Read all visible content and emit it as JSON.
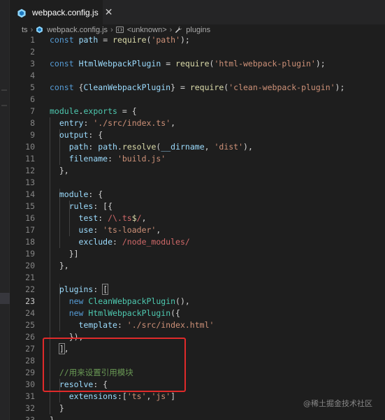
{
  "tab": {
    "filename": "webpack.config.js",
    "close_glyph": "✕",
    "icon": "gear-file-icon"
  },
  "breadcrumb": {
    "items": [
      {
        "label": "ts",
        "icon": ""
      },
      {
        "label": "webpack.config.js",
        "icon": "gear-file-icon"
      },
      {
        "label": "<unknown>",
        "icon": "braces-icon"
      },
      {
        "label": "plugins",
        "icon": "wrench-icon"
      }
    ]
  },
  "editor": {
    "active_line": 23,
    "lines": [
      [
        [
          "kw",
          "const"
        ],
        [
          "p",
          " "
        ],
        [
          "var",
          "path"
        ],
        [
          "p",
          " = "
        ],
        [
          "fn",
          "require"
        ],
        [
          "p",
          "("
        ],
        [
          "str",
          "'path'"
        ],
        [
          "p",
          ");"
        ]
      ],
      [],
      [
        [
          "kw",
          "const"
        ],
        [
          "p",
          " "
        ],
        [
          "var",
          "HtmlWebpackPlugin"
        ],
        [
          "p",
          " = "
        ],
        [
          "fn",
          "require"
        ],
        [
          "p",
          "("
        ],
        [
          "str",
          "'html-webpack-plugin'"
        ],
        [
          "p",
          ");"
        ]
      ],
      [],
      [
        [
          "kw",
          "const"
        ],
        [
          "p",
          " {"
        ],
        [
          "var",
          "CleanWebpackPlugin"
        ],
        [
          "p",
          "} = "
        ],
        [
          "fn",
          "require"
        ],
        [
          "p",
          "("
        ],
        [
          "str",
          "'clean-webpack-plugin'"
        ],
        [
          "p",
          ");"
        ]
      ],
      [],
      [
        [
          "cls",
          "module"
        ],
        [
          "p",
          "."
        ],
        [
          "cls",
          "exports"
        ],
        [
          "p",
          " = {"
        ]
      ],
      [
        [
          "p",
          "  "
        ],
        [
          "var",
          "entry"
        ],
        [
          "p",
          ": "
        ],
        [
          "str",
          "'./src/index.ts'"
        ],
        [
          "p",
          ","
        ]
      ],
      [
        [
          "p",
          "  "
        ],
        [
          "var",
          "output"
        ],
        [
          "p",
          ": {"
        ]
      ],
      [
        [
          "p",
          "    "
        ],
        [
          "var",
          "path"
        ],
        [
          "p",
          ": "
        ],
        [
          "var",
          "path"
        ],
        [
          "p",
          "."
        ],
        [
          "fn",
          "resolve"
        ],
        [
          "p",
          "("
        ],
        [
          "var",
          "__dirname"
        ],
        [
          "p",
          ", "
        ],
        [
          "str",
          "'dist'"
        ],
        [
          "p",
          "),"
        ]
      ],
      [
        [
          "p",
          "    "
        ],
        [
          "var",
          "filename"
        ],
        [
          "p",
          ": "
        ],
        [
          "str",
          "'build.js'"
        ]
      ],
      [
        [
          "p",
          "  },"
        ]
      ],
      [],
      [
        [
          "p",
          "  "
        ],
        [
          "var",
          "module"
        ],
        [
          "p",
          ": {"
        ]
      ],
      [
        [
          "p",
          "    "
        ],
        [
          "var",
          "rules"
        ],
        [
          "p",
          ": [{"
        ]
      ],
      [
        [
          "p",
          "      "
        ],
        [
          "var",
          "test"
        ],
        [
          "p",
          ": "
        ],
        [
          "rx",
          "/\\.ts"
        ],
        [
          "rxs",
          "$"
        ],
        [
          "rx",
          "/"
        ],
        [
          "p",
          ","
        ]
      ],
      [
        [
          "p",
          "      "
        ],
        [
          "var",
          "use"
        ],
        [
          "p",
          ": "
        ],
        [
          "str",
          "'ts-loader'"
        ],
        [
          "p",
          ","
        ]
      ],
      [
        [
          "p",
          "      "
        ],
        [
          "var",
          "exclude"
        ],
        [
          "p",
          ": "
        ],
        [
          "rx",
          "/node_modules/"
        ]
      ],
      [
        [
          "p",
          "    }]"
        ]
      ],
      [
        [
          "p",
          "  },"
        ]
      ],
      [],
      [
        [
          "p",
          "  "
        ],
        [
          "var",
          "plugins"
        ],
        [
          "p",
          ": "
        ],
        [
          "pb",
          "["
        ]
      ],
      [
        [
          "p",
          "    "
        ],
        [
          "kw",
          "new"
        ],
        [
          "p",
          " "
        ],
        [
          "cls",
          "CleanWebpackPlugin"
        ],
        [
          "p",
          "(),"
        ]
      ],
      [
        [
          "p",
          "    "
        ],
        [
          "kw",
          "new"
        ],
        [
          "p",
          " "
        ],
        [
          "cls",
          "HtmlWebpackPlugin"
        ],
        [
          "p",
          "({"
        ]
      ],
      [
        [
          "p",
          "      "
        ],
        [
          "var",
          "template"
        ],
        [
          "p",
          ": "
        ],
        [
          "str",
          "'./src/index.html'"
        ]
      ],
      [
        [
          "p",
          "    }),"
        ]
      ],
      [
        [
          "p",
          "  "
        ],
        [
          "pb",
          "]"
        ],
        [
          "p",
          ","
        ]
      ],
      [],
      [
        [
          "p",
          "  "
        ],
        [
          "cmt",
          "//用来设置引用模块"
        ]
      ],
      [
        [
          "p",
          "  "
        ],
        [
          "var",
          "resolve"
        ],
        [
          "p",
          ": {"
        ]
      ],
      [
        [
          "p",
          "    "
        ],
        [
          "var",
          "extensions"
        ],
        [
          "p",
          ":["
        ],
        [
          "str",
          "'ts'"
        ],
        [
          "p",
          ","
        ],
        [
          "str",
          "'js'"
        ],
        [
          "p",
          "]"
        ]
      ],
      [
        [
          "p",
          "  }"
        ]
      ],
      [
        [
          "p",
          "}"
        ]
      ]
    ]
  },
  "watermark": "@稀土掘金技术社区",
  "colors": {
    "background": "#1e1e1e",
    "keyword": "#569cd6",
    "variable": "#9cdcfe",
    "function": "#dcdcaa",
    "string": "#ce9178",
    "class": "#4ec9b0",
    "comment": "#6a9955",
    "regex": "#d16969",
    "highlight_box": "#e02a2a"
  }
}
